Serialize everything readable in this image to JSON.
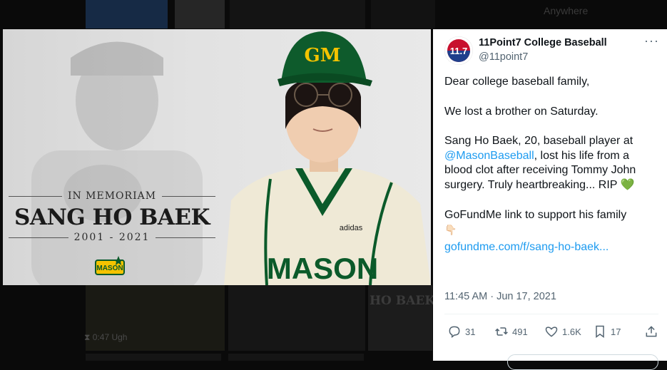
{
  "backdrop": {
    "anywhere": "Anywhere",
    "caption": "⧗ 0:47 Ugh",
    "name_fragment": "HO BAEK"
  },
  "media": {
    "memoriam_label": "IN MEMORIAM",
    "player_name": "SANG HO BAEK",
    "years": "2001 - 2021",
    "cap_letters": "GM",
    "jersey_brand": "adidas",
    "jersey_text": "MASON",
    "logo_text": "MASON"
  },
  "tweet": {
    "avatar_text": "11.7",
    "display_name": "11Point7 College Baseball",
    "handle": "@11point7",
    "more": "···",
    "p1": "Dear college baseball family,",
    "p2": "We lost a brother on Saturday.",
    "p3_a": "Sang Ho Baek, 20, baseball player at ",
    "p3_link": "@MasonBaseball",
    "p3_b": ", lost his life from a blood clot after receiving Tommy John surgery. Truly heartbreaking... RIP ",
    "p3_emoji": "💚",
    "p4": "GoFundMe link to support his family",
    "p4_emoji": "👇🏻",
    "p5_link": "gofundme.com/f/sang-ho-baek...",
    "timestamp": "11:45 AM · Jun 17, 2021",
    "replies": "31",
    "retweets": "491",
    "likes": "1.6K",
    "bookmarks": "17"
  },
  "colors": {
    "link": "#1d9bf0",
    "mason_green": "#0b5a2a",
    "mason_gold": "#f4c300",
    "muted": "#536471"
  }
}
